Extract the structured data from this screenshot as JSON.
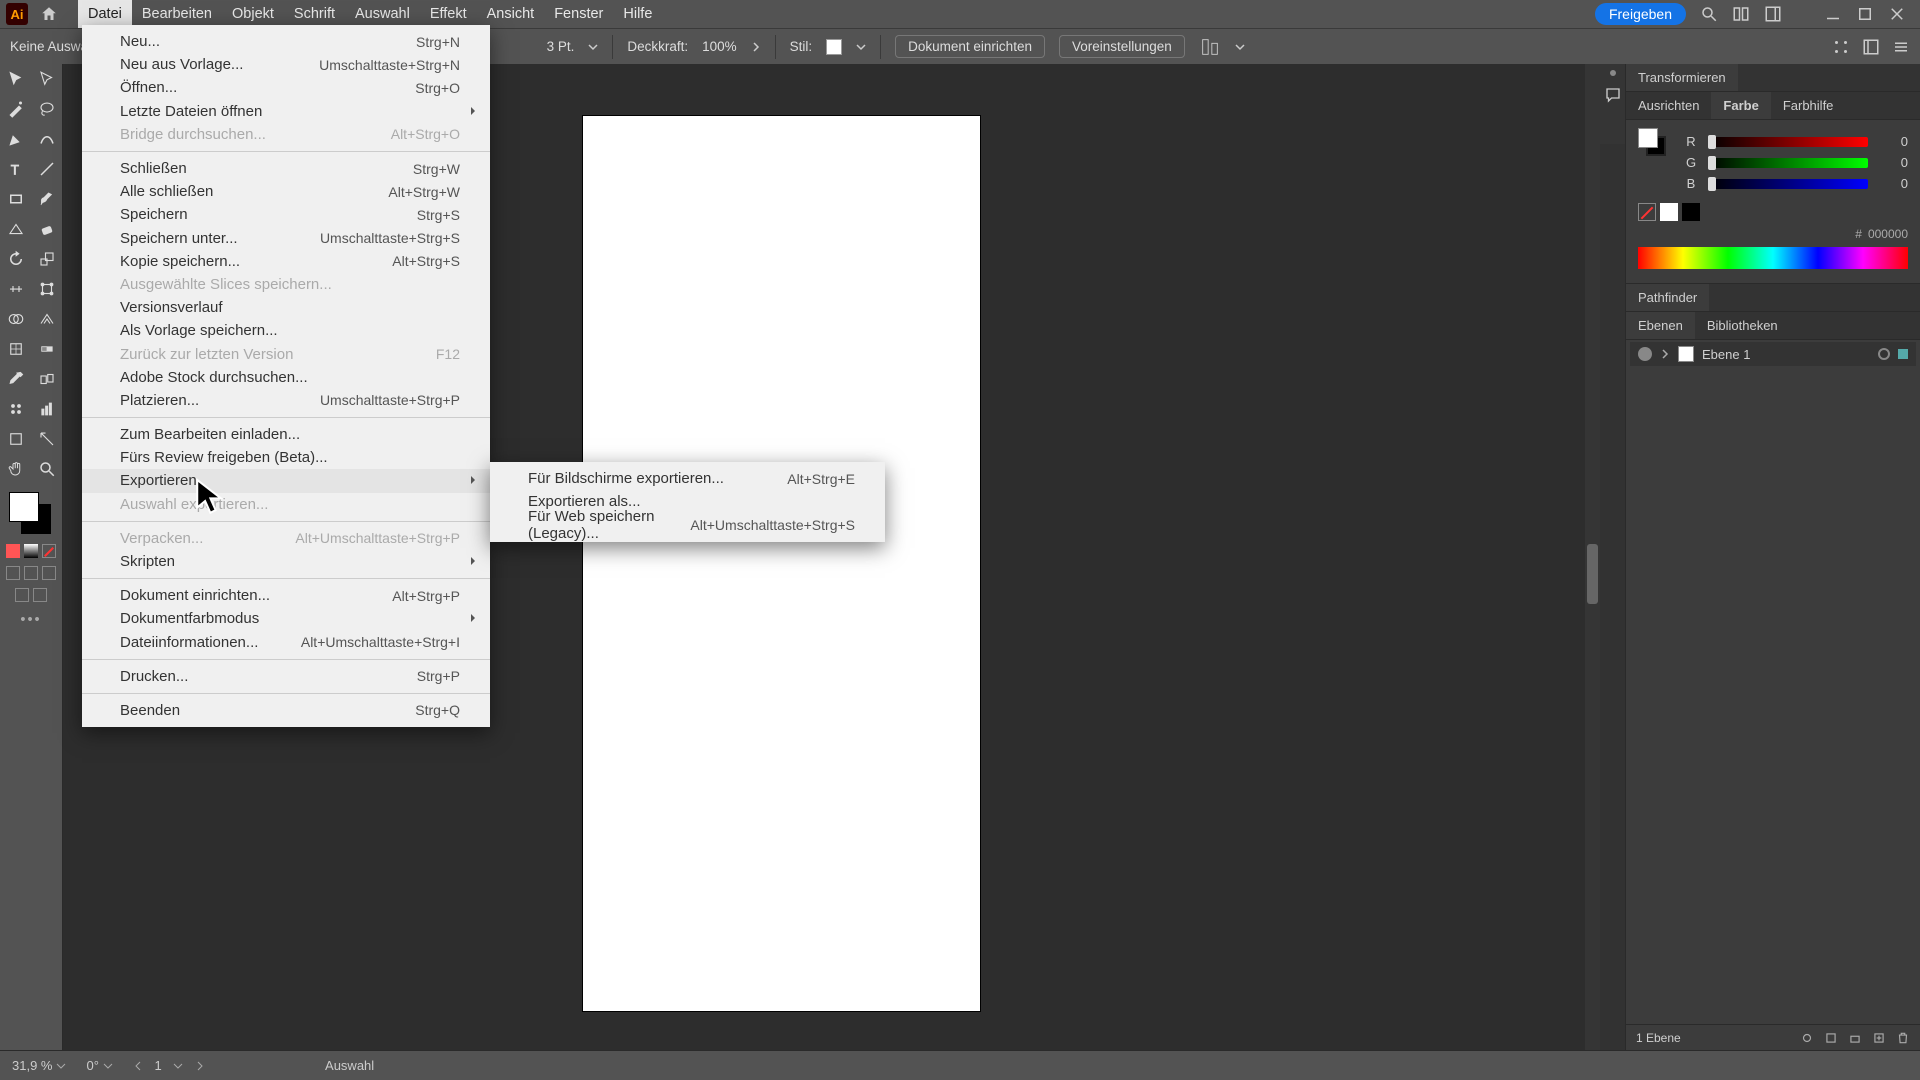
{
  "menubar": {
    "items": [
      "Datei",
      "Bearbeiten",
      "Objekt",
      "Schrift",
      "Auswahl",
      "Effekt",
      "Ansicht",
      "Fenster",
      "Hilfe"
    ],
    "share": "Freigeben"
  },
  "optbar": {
    "noselect": "Keine Auswahl",
    "strokeval": "3 Pt.",
    "opacity_label": "Deckkraft:",
    "opacity_val": "100%",
    "style_label": "Stil:",
    "docsetup": "Dokument einrichten",
    "prefs": "Voreinstellungen"
  },
  "file_menu": [
    {
      "l": "Neu...",
      "s": "Strg+N"
    },
    {
      "l": "Neu aus Vorlage...",
      "s": "Umschalttaste+Strg+N"
    },
    {
      "l": "Öffnen...",
      "s": "Strg+O"
    },
    {
      "l": "Letzte Dateien öffnen",
      "sub": true
    },
    {
      "l": "Bridge durchsuchen...",
      "s": "Alt+Strg+O",
      "dis": true
    },
    {
      "sep": true
    },
    {
      "l": "Schließen",
      "s": "Strg+W"
    },
    {
      "l": "Alle schließen",
      "s": "Alt+Strg+W"
    },
    {
      "l": "Speichern",
      "s": "Strg+S"
    },
    {
      "l": "Speichern unter...",
      "s": "Umschalttaste+Strg+S"
    },
    {
      "l": "Kopie speichern...",
      "s": "Alt+Strg+S"
    },
    {
      "l": "Ausgewählte Slices speichern...",
      "dis": true
    },
    {
      "l": "Versionsverlauf"
    },
    {
      "l": "Als Vorlage speichern..."
    },
    {
      "l": "Zurück zur letzten Version",
      "s": "F12",
      "dis": true
    },
    {
      "l": "Adobe Stock durchsuchen..."
    },
    {
      "l": "Platzieren...",
      "s": "Umschalttaste+Strg+P"
    },
    {
      "sep": true
    },
    {
      "l": "Zum Bearbeiten einladen..."
    },
    {
      "l": "Fürs Review freigeben (Beta)..."
    },
    {
      "l": "Exportieren",
      "sub": true,
      "hov": true
    },
    {
      "l": "Auswahl exportieren...",
      "dis": true
    },
    {
      "sep": true
    },
    {
      "l": "Verpacken...",
      "s": "Alt+Umschalttaste+Strg+P",
      "dis": true
    },
    {
      "l": "Skripten",
      "sub": true
    },
    {
      "sep": true
    },
    {
      "l": "Dokument einrichten...",
      "s": "Alt+Strg+P"
    },
    {
      "l": "Dokumentfarbmodus",
      "sub": true
    },
    {
      "l": "Dateiinformationen...",
      "s": "Alt+Umschalttaste+Strg+I"
    },
    {
      "sep": true
    },
    {
      "l": "Drucken...",
      "s": "Strg+P"
    },
    {
      "sep": true
    },
    {
      "l": "Beenden",
      "s": "Strg+Q"
    }
  ],
  "export_sub": [
    {
      "l": "Für Bildschirme exportieren...",
      "s": "Alt+Strg+E"
    },
    {
      "l": "Exportieren als..."
    },
    {
      "l": "Für Web speichern (Legacy)...",
      "s": "Alt+Umschalttaste+Strg+S"
    }
  ],
  "panels": {
    "transform": "Transformieren",
    "align": "Ausrichten",
    "color": "Farbe",
    "guide": "Farbhilfe",
    "pathfinder": "Pathfinder",
    "layers": "Ebenen",
    "libs": "Bibliotheken",
    "r": "R",
    "g": "G",
    "b": "B",
    "rv": "0",
    "gv": "0",
    "bv": "0",
    "hex_hash": "#",
    "hex": "000000",
    "layer1": "Ebene 1",
    "layer_count": "1 Ebene"
  },
  "status": {
    "zoom": "31,9 %",
    "rot": "0°",
    "art": "1",
    "tool": "Auswahl"
  }
}
